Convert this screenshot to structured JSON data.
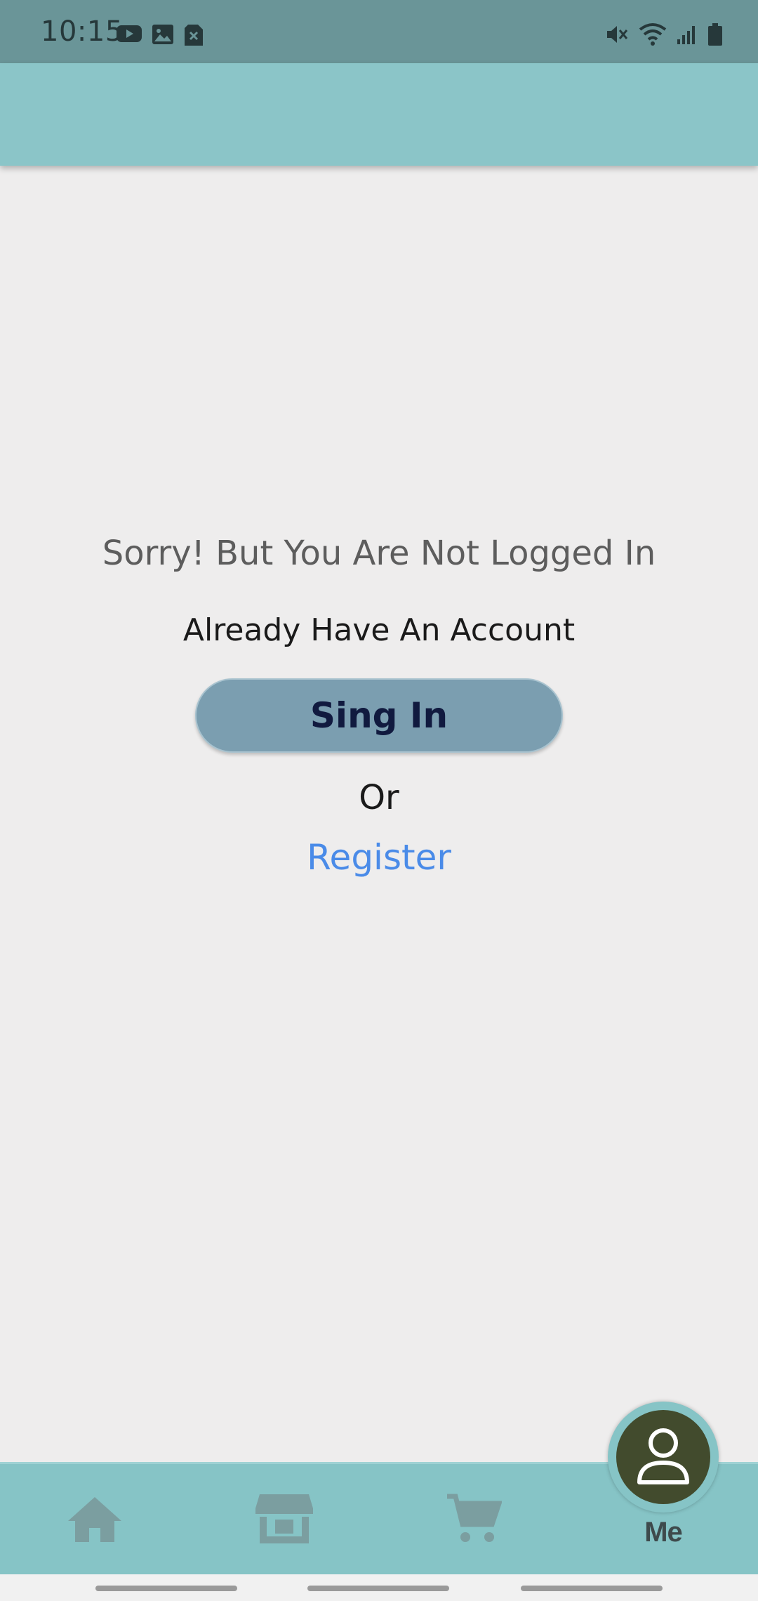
{
  "status_bar": {
    "time": "10:15",
    "left_icons": [
      "youtube-icon",
      "image-icon",
      "sim-error-icon"
    ],
    "right_icons": [
      "vibrate-mute-icon",
      "wifi-icon",
      "signal-icon",
      "battery-icon"
    ]
  },
  "message": {
    "title": "Sorry! But You Are Not Logged In",
    "subtitle": "Already Have An Account",
    "signin_label": "Sing In",
    "or_label": "Or",
    "register_label": "Register"
  },
  "bottom_nav": {
    "items": [
      {
        "icon": "home-icon"
      },
      {
        "icon": "store-icon"
      },
      {
        "icon": "cart-icon"
      },
      {
        "icon": "user-icon",
        "label": "Me",
        "active": true
      }
    ]
  },
  "colors": {
    "app_bar": "#8bc5c8",
    "status_bar": "#6a9598",
    "button": "#7b9eb0",
    "link": "#4a8be8",
    "fab": "#424b2d"
  }
}
